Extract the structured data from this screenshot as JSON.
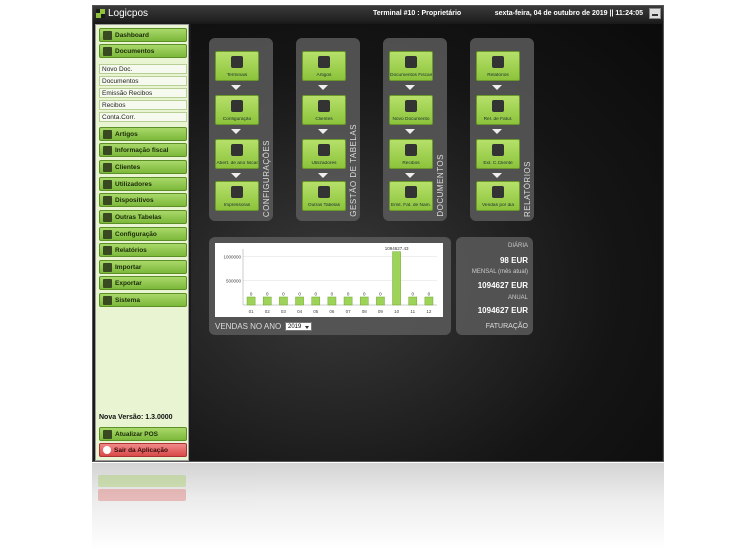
{
  "titlebar": {
    "logo_text": "Logicpos",
    "terminal": "Terminal #10 : Proprietário",
    "datetime": "sexta-feira, 04 de outubro de 2019 || 11:24:05"
  },
  "sidebar": {
    "buttons": [
      {
        "label": "Dashboard",
        "icon": "dashboard-icon"
      },
      {
        "label": "Documentos",
        "icon": "documents-icon"
      }
    ],
    "subitems": [
      "Novo Doc.",
      "Documentos",
      "Emissão Recibos",
      "Recibos",
      "Conta.Corr."
    ],
    "menu": [
      {
        "label": "Artigos",
        "icon": "grid-icon"
      },
      {
        "label": "Informação fiscal",
        "icon": "dollar-icon"
      },
      {
        "label": "Clientes",
        "icon": "user-icon"
      },
      {
        "label": "Utilizadores",
        "icon": "user-icon"
      },
      {
        "label": "Dispositivos",
        "icon": "device-icon"
      },
      {
        "label": "Outras Tabelas",
        "icon": "list-icon"
      },
      {
        "label": "Configuração",
        "icon": "gear-icon"
      },
      {
        "label": "Relatórios",
        "icon": "report-icon"
      },
      {
        "label": "Importar",
        "icon": "import-icon"
      },
      {
        "label": "Exportar",
        "icon": "export-icon"
      },
      {
        "label": "Sistema",
        "icon": "system-icon"
      }
    ],
    "version": "Nova Versão: 1.3.0000",
    "update_label": "Atualizar POS",
    "exit_label": "Sair da Aplicação"
  },
  "columns": [
    {
      "title": "CONFIGURAÇÕES",
      "tiles": [
        "Terminais",
        "Configuração",
        "Abert. de ano fiscal",
        "Impressoras"
      ]
    },
    {
      "title": "GESTÃO DE TABELAS",
      "tiles": [
        "Artigos",
        "Clientes",
        "Utilizadores",
        "Outras Tabelas"
      ]
    },
    {
      "title": "DOCUMENTOS",
      "tiles": [
        "Documentos Fiscais",
        "Novo Documento",
        "Recibos",
        "Emit. Fat. de Nam."
      ]
    },
    {
      "title": "RELATÓRIOS",
      "tiles": [
        "Relatórios",
        "Rel. de Fatur.",
        "Ext. C.Cliente",
        "Vendas por dia"
      ]
    }
  ],
  "sales": {
    "label": "VENDAS NO ANO",
    "year": "2019"
  },
  "chart_data": {
    "type": "bar",
    "categories": [
      "01",
      "02",
      "03",
      "04",
      "05",
      "06",
      "07",
      "08",
      "09",
      "10",
      "11",
      "12"
    ],
    "values": [
      0,
      0,
      0,
      0,
      0,
      0,
      0,
      0,
      0,
      1094627.43,
      0,
      0
    ],
    "value_labels": [
      "0",
      "0",
      "0",
      "0",
      "0",
      "0",
      "0",
      "0",
      "0",
      "1094627.43",
      "0",
      "0"
    ],
    "yticks": [
      "1000000",
      "500000"
    ],
    "ylim": [
      0,
      1150000
    ],
    "grid": true,
    "colors": {
      "bar": "#9ed35a",
      "bar_border": "#6da82c"
    }
  },
  "faturacao": {
    "diaria_label": "DIÁRIA",
    "diaria_value": "98 EUR",
    "mensal_label": "MENSAL (mês atual)",
    "mensal_value": "1094627 EUR",
    "anual_label": "ANUAL",
    "anual_value": "1094627 EUR",
    "title": "FATURAÇÃO"
  },
  "colors": {
    "accent": "#8fc23c",
    "danger": "#d94a4a"
  }
}
